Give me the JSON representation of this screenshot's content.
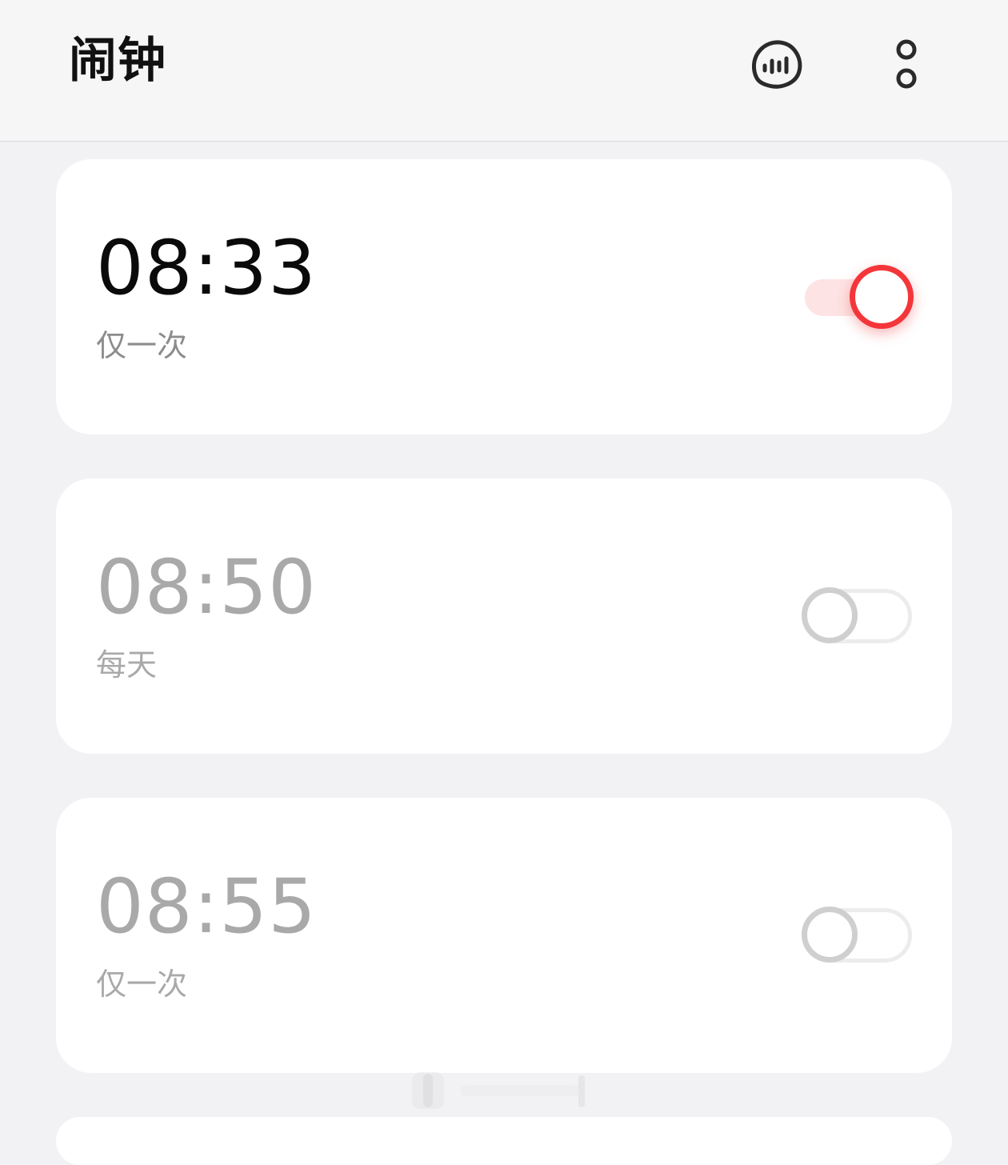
{
  "app_bar": {
    "title": "闹钟",
    "voice_icon": "voice-waveform-icon",
    "more_icon": "more-vertical-icon"
  },
  "alarms": [
    {
      "time": "08:33",
      "repeat": "仅一次",
      "enabled": true
    },
    {
      "time": "08:50",
      "repeat": "每天",
      "enabled": false
    },
    {
      "time": "08:55",
      "repeat": "仅一次",
      "enabled": false
    }
  ],
  "colors": {
    "accent": "#f4363b",
    "accent_track": "#fde3e3",
    "background": "#f2f2f4",
    "card": "#ffffff",
    "text_primary": "#0a0a0a",
    "text_disabled": "#a9a9a9"
  }
}
